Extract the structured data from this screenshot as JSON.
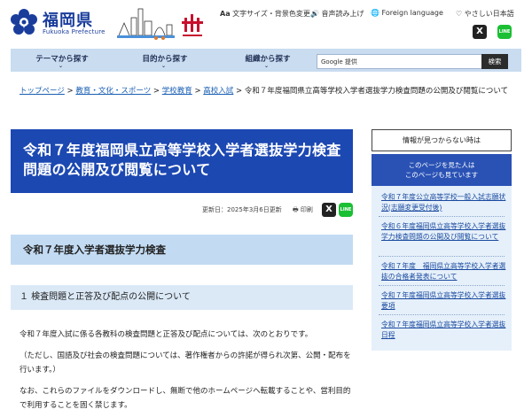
{
  "header": {
    "logo_text": "福岡県",
    "logo_sub": "Fukuoka Prefecture",
    "tools": [
      {
        "icon": "text-size-icon",
        "label": "文字サイズ・背景色変更"
      },
      {
        "icon": "speaker-icon",
        "label": "音声読み上げ"
      },
      {
        "icon": "globe-icon",
        "label": "Foreign language"
      },
      {
        "icon": "heart-icon",
        "label": "やさしい日本語"
      }
    ]
  },
  "nav": {
    "items": [
      "テーマから探す",
      "目的から探す",
      "組織から探す"
    ],
    "search_label": "Google 提供",
    "search_button": "検索"
  },
  "breadcrumb": {
    "items": [
      "トップページ",
      "教育・文化・スポーツ",
      "学校教育",
      "高校入試"
    ],
    "current": "令和７年度福岡県立高等学校入学者選抜学力検査問題の公開及び閲覧について"
  },
  "page": {
    "title_line1": "令和７年度福岡県立高等学校入学者選抜学力検査",
    "title_line2": "問題の公開及び閲覧について",
    "updated": "更新日：2025年3月6日更新",
    "print": "印刷",
    "h2": "令和７年度入学者選抜学力検査",
    "h3": "１ 検査問題と正答及び配点の公開について",
    "paragraphs": [
      "令和７年度入試に係る各教科の検査問題と正答及び配点については、次のとおりです。",
      "（ただし、国語及び社会の検査問題については、著作権者からの許諾が得られ次第、公開・配布を行います。）",
      "なお、これらのファイルをダウンロードし、無断で他のホームページへ転載することや、営利目的で利用することを固く禁じます。"
    ]
  },
  "sidebar": {
    "not_found": "情報が見つからない時は",
    "related_heading_1": "このページを見た人は",
    "related_heading_2": "このページも見ています",
    "links": [
      "令和７年度公立高等学校一般入試志願状況(志願変更受付後)",
      "令和６年度福岡県立高等学校入学者選抜学力検査問題の公開及び閲覧について",
      "令和７年度　福岡県立高等学校入学者選抜の合格者発表について",
      "令和７年度福岡県立高等学校入学者選抜要項",
      "令和７年度福岡県立高等学校入学者選抜日程"
    ]
  },
  "colors": {
    "brand": "#1c48b2",
    "nav_bg": "#c9dcf0",
    "h2_bg": "#c2dbf3",
    "link": "#1a5fb4"
  }
}
